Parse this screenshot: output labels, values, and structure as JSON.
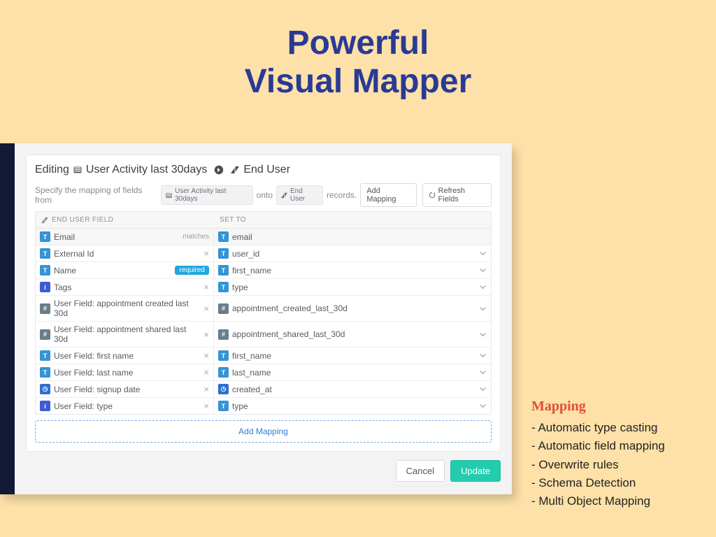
{
  "headline": {
    "line1": "Powerful",
    "line2": "Visual  Mapper"
  },
  "features": {
    "title": "Mapping",
    "items": [
      "- Automatic type casting",
      "- Automatic field mapping",
      "- Overwrite rules",
      "- Schema Detection",
      "- Multi Object Mapping"
    ]
  },
  "panel": {
    "editing_prefix": "Editing",
    "source_label": "User Activity last 30days",
    "dest_label": "End User",
    "subline_prefix": "Specify the mapping of fields from",
    "subline_source": "User Activity last 30days",
    "subline_mid": "onto",
    "subline_dest": "End User",
    "subline_suffix": "records.",
    "add_mapping_btn": "Add Mapping",
    "refresh_btn": "Refresh Fields",
    "th_left": "END USER FIELD",
    "th_right": "SET TO",
    "matches_label": "matches",
    "required_label": "required",
    "add_mapping_bar": "Add Mapping",
    "cancel": "Cancel",
    "update": "Update"
  },
  "rows": [
    {
      "left_icon": "T",
      "left_label": "Email",
      "left_ctl": "matches",
      "right_icon": "T",
      "right_label": "email",
      "muted": true,
      "chev": false
    },
    {
      "left_icon": "T",
      "left_label": "External Id",
      "left_ctl": "x",
      "right_icon": "T",
      "right_label": "user_id",
      "muted": false,
      "chev": true
    },
    {
      "left_icon": "T",
      "left_label": "Name",
      "left_ctl": "required",
      "right_icon": "T",
      "right_label": "first_name",
      "muted": false,
      "chev": true
    },
    {
      "left_icon": "i",
      "left_label": "Tags",
      "left_ctl": "x",
      "right_icon": "T",
      "right_label": "type",
      "muted": false,
      "chev": true
    },
    {
      "left_icon": "H",
      "left_label": "User Field: appointment created last 30d",
      "left_ctl": "x",
      "right_icon": "H",
      "right_label": "appointment_created_last_30d",
      "muted": false,
      "chev": true
    },
    {
      "left_icon": "H",
      "left_label": "User Field: appointment shared last 30d",
      "left_ctl": "x",
      "right_icon": "H",
      "right_label": "appointment_shared_last_30d",
      "muted": false,
      "chev": true
    },
    {
      "left_icon": "T",
      "left_label": "User Field: first name",
      "left_ctl": "x",
      "right_icon": "T",
      "right_label": "first_name",
      "muted": false,
      "chev": true
    },
    {
      "left_icon": "T",
      "left_label": "User Field: last name",
      "left_ctl": "x",
      "right_icon": "T",
      "right_label": "last_name",
      "muted": false,
      "chev": true
    },
    {
      "left_icon": "O",
      "left_label": "User Field: signup date",
      "left_ctl": "x",
      "right_icon": "O",
      "right_label": "created_at",
      "muted": false,
      "chev": true
    },
    {
      "left_icon": "i",
      "left_label": "User Field: type",
      "left_ctl": "x",
      "right_icon": "T",
      "right_label": "type",
      "muted": false,
      "chev": true
    }
  ]
}
